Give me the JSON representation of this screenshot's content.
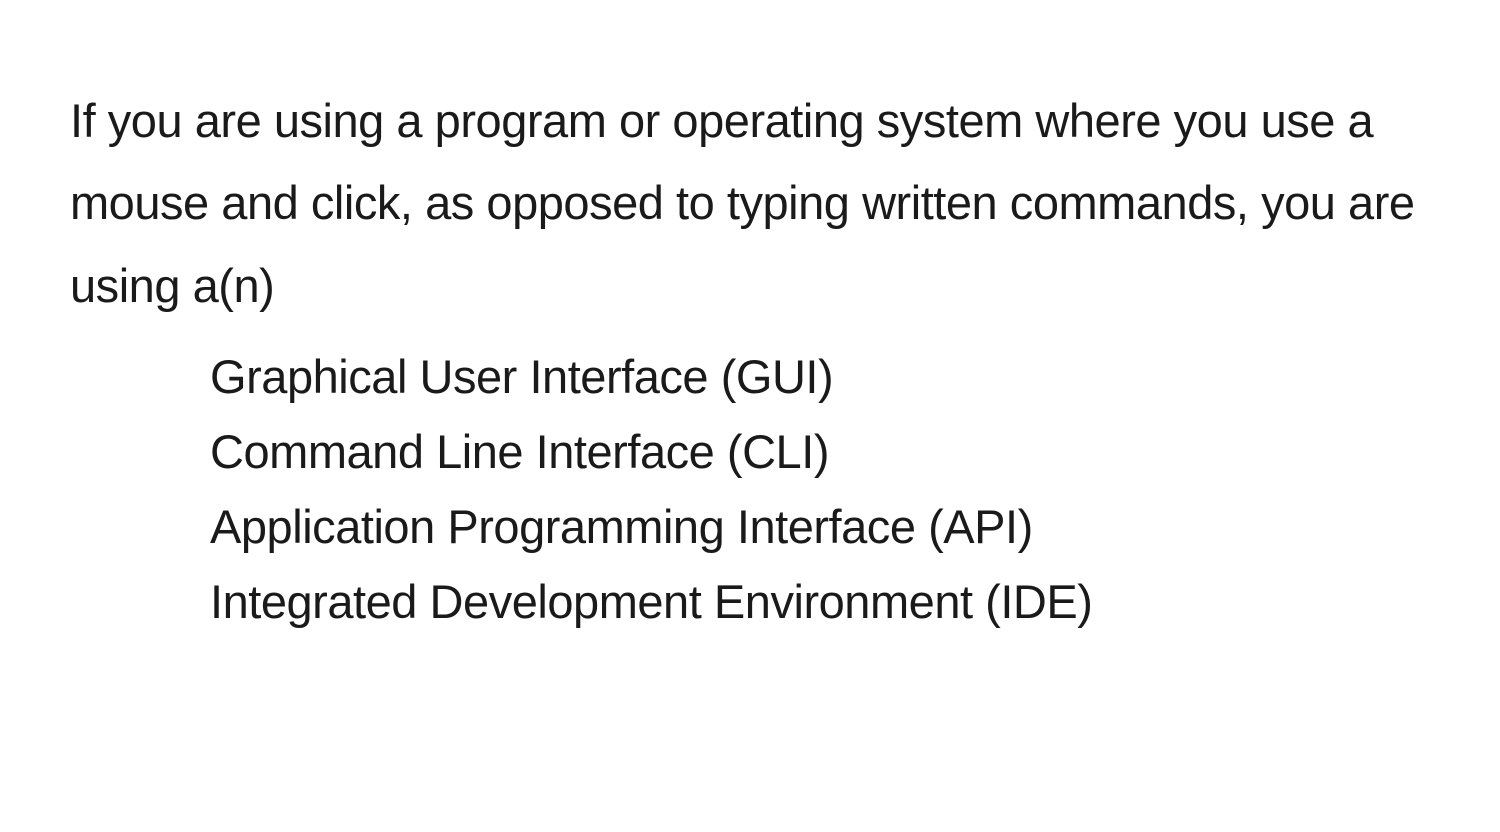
{
  "question": {
    "prompt": "If you are using a program or operating system where you use a mouse and click, as opposed to typing written commands, you are using a(n)",
    "options": [
      "Graphical User Interface (GUI)",
      "Command Line Interface (CLI)",
      "Application Programming Interface (API)",
      "Integrated Development Environment (IDE)"
    ]
  }
}
